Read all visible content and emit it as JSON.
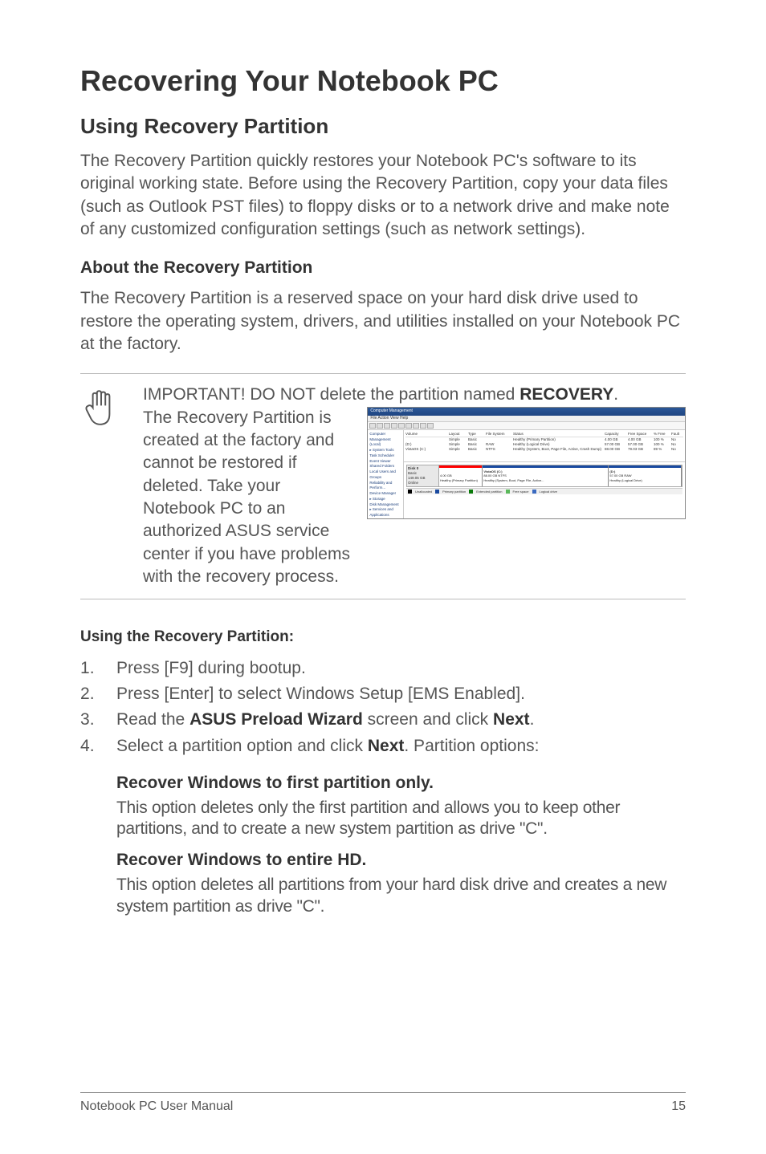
{
  "title": "Recovering Your Notebook PC",
  "section1": {
    "heading": "Using Recovery Partition",
    "body": "The Recovery Partition quickly restores your Notebook PC's software to its original working state. Before using the Recovery Partition, copy your data files (such as Outlook PST files) to floppy disks or to a network drive and make note of any customized configuration settings (such as network settings).",
    "subheading": "About the Recovery Partition",
    "subbody": "The Recovery Partition is a reserved space on your hard disk drive used to restore the operating system, drivers, and utilities installed on your Notebook PC at the factory."
  },
  "notice": {
    "line1_a": "IMPORTANT! DO NOT delete the partition named ",
    "line1_b": "RECOVERY",
    "line1_c": ". The Recovery Partition is created at the factory and cannot be restored if deleted. Take your Notebook PC to an authorized ASUS service center if you have problems with the recovery process."
  },
  "cm": {
    "title": "Computer Management",
    "menu": "File   Action   View   Help",
    "tree": "Computer Management (Local)\n  ▸ System Tools\n    Task Scheduler\n    Event Viewer\n    Shared Folders\n    Local Users and Groups\n    Reliability and Perform...\n    Device Manager\n  ▸ Storage\n    Disk Management\n  ▸ Services and Applications",
    "grid_header": [
      "Volume",
      "Layout",
      "Type",
      "File System",
      "Status",
      "Capacity",
      "Free Space",
      "% Free",
      "Fault"
    ],
    "grid_rows": [
      [
        "",
        "Simple",
        "Basic",
        "",
        "Healthy (Primary Partition)",
        "4.00 GB",
        "4.00 GB",
        "100 %",
        "No"
      ],
      [
        "(D:)",
        "Simple",
        "Basic",
        "RAW",
        "Healthy (Logical Drive)",
        "57.00 GB",
        "57.00 GB",
        "100 %",
        "No"
      ],
      [
        "VistaOS (C:)",
        "Simple",
        "Basic",
        "NTFS",
        "Healthy (System, Boot, Page File, Active, Crash Dump)",
        "88.00 GB",
        "79.03 GB",
        "89 %",
        "No"
      ]
    ],
    "disk": {
      "label_name": "Disk 0",
      "label_type": "Basic",
      "label_size": "149.05 GB",
      "label_status": "Online",
      "parts": [
        {
          "name": "",
          "size": "4.00 GB",
          "status": "Healthy (Primary Partition)",
          "color": "#ff0000",
          "width": "18%"
        },
        {
          "name": "VistaOS (C:)",
          "size": "88.00 GB NTFS",
          "status": "Healthy (System, Boot, Page File, Active...",
          "color": "#1a4aa0",
          "width": "52%"
        },
        {
          "name": "(D:)",
          "size": "57.00 GB RAW",
          "status": "Healthy (Logical Drive)",
          "color": "#1a4aa0",
          "width": "30%"
        }
      ]
    },
    "legend": [
      "Unallocated",
      "Primary partition",
      "Extended partition",
      "Free space",
      "Logical drive"
    ]
  },
  "usage": {
    "heading": "Using the Recovery Partition:",
    "steps": [
      {
        "text": "Press [F9] during bootup."
      },
      {
        "text": "Press [Enter] to select Windows Setup [EMS Enabled]."
      },
      {
        "text_a": "Read the ",
        "bold_a": "ASUS Preload Wizard",
        "text_b": " screen and click ",
        "bold_b": "Next",
        "text_c": "."
      },
      {
        "text_a": "Select a partition option and click ",
        "bold_a": "Next",
        "text_b": ". Partition options:"
      }
    ],
    "options": [
      {
        "title": "Recover Windows to first partition only.",
        "desc": "This option deletes only the first partition and allows you to keep other partitions, and to create a new system partition as drive \"C\"."
      },
      {
        "title": "Recover Windows to entire HD.",
        "desc": "This option deletes all partitions from your hard disk drive and creates a new system partition as drive \"C\"."
      }
    ]
  },
  "footer": {
    "left": "Notebook PC User Manual",
    "right": "15"
  }
}
